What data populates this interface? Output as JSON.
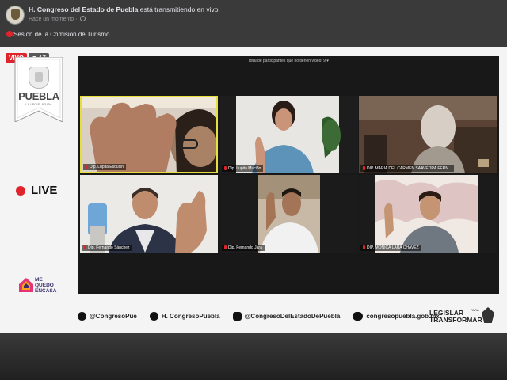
{
  "post": {
    "page_name": "H. Congreso del Estado de Puebla",
    "action_text": " está transmitiendo en vivo.",
    "time": "Hace un momento",
    "meta_sep": " · ",
    "description": "Sesión de la Comisión de Turismo."
  },
  "video": {
    "vivo_label": "VIVO",
    "viewer_count": "17",
    "logo": {
      "name": "PUEBLA",
      "subtitle": "LX LEGISLATURA"
    },
    "live_label": "LIVE",
    "me_quedo": [
      "ME",
      "QUEDO",
      "ENCASA"
    ],
    "zoom_header": "Total de participantes que no tienen video: 9",
    "participants": [
      {
        "name": "Dip. Lupita Esquitin",
        "active": true
      },
      {
        "name": "Dip. Lupita Muciño",
        "active": false
      },
      {
        "name": "DIP. MARIA DEL CARMEN SAAVEDRA FERN...",
        "active": false
      },
      {
        "name": "Dip. Fernando Sánchez",
        "active": false
      },
      {
        "name": "Dip. Fernando Jara",
        "active": false
      },
      {
        "name": "DIP. MONICA LARA CHAVEZ",
        "active": false
      }
    ],
    "social": {
      "twitter": "@CongresoPue",
      "facebook": "H. CongresoPuebla",
      "instagram": "@CongresoDelEstadoDePuebla",
      "website": "congresopuebla.gob.mx"
    },
    "brand": {
      "line1": "LEGISLAR",
      "para": "PARA",
      "line2": "TRANSFORMAR"
    }
  },
  "colors": {
    "live_red": "#e0242b",
    "active_speaker": "#e6df3c",
    "zoom_bg": "#181818"
  }
}
